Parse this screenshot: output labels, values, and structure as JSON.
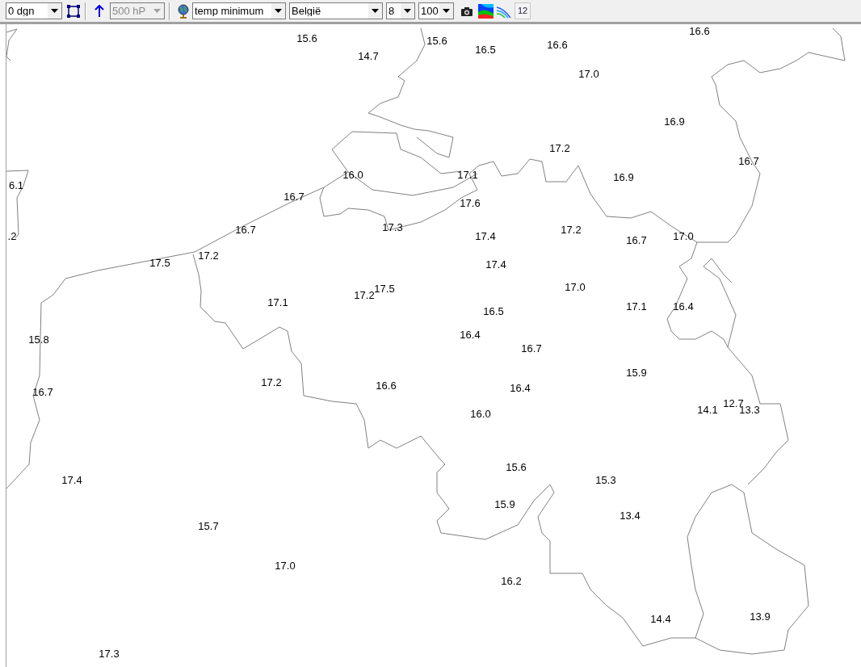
{
  "toolbar": {
    "dropdowns": [
      {
        "value": "0 dgn",
        "disabled": false
      },
      {
        "value": "500 hP",
        "disabled": true
      },
      {
        "value": "temp minimum",
        "disabled": false
      },
      {
        "value": "België",
        "disabled": false
      },
      {
        "value": "8",
        "disabled": false
      },
      {
        "value": "100",
        "disabled": false
      }
    ],
    "number_button": "12"
  },
  "map": {
    "labels": [
      "15.6",
      "14.7",
      "15.6",
      "16.5",
      "16.6",
      "16.6",
      "17.0",
      "16.9",
      "17.2",
      "16.7",
      "6.1",
      "16.0",
      "17.1",
      "16.9",
      "16.7",
      "17.6",
      ".2",
      "16.7",
      "17.3",
      "17.4",
      "17.2",
      "16.7",
      "17.0",
      "17.5",
      "17.2",
      "17.4",
      "17.0",
      "17.5",
      "17.2",
      "17.1",
      "16.5",
      "17.1",
      "16.4",
      "15.8",
      "16.4",
      "16.7",
      "15.9",
      "17.2",
      "16.6",
      "16.4",
      "16.7",
      "14.1",
      "12.7",
      "13.3",
      "16.0",
      "15.6",
      "15.3",
      "17.4",
      "15.9",
      "13.4",
      "15.7",
      "17.0",
      "16.2",
      "14.4",
      "13.9",
      "17.3"
    ]
  }
}
